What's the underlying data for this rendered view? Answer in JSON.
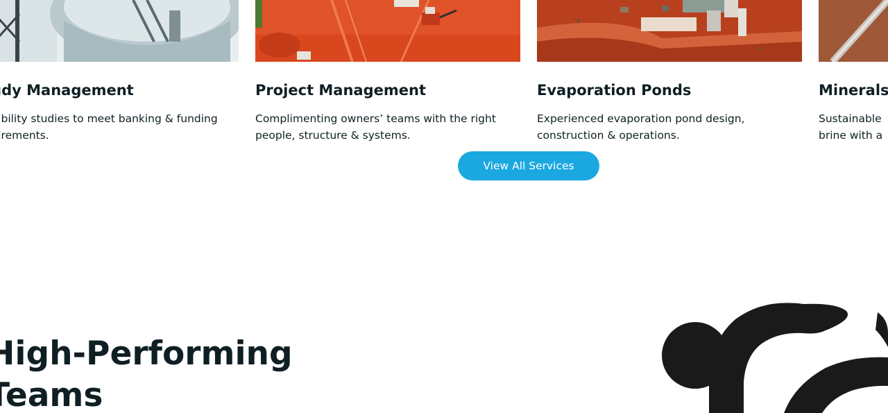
{
  "services": [
    {
      "title": "Study Management",
      "description_lines": [
        "Feasibility studies to meet banking & funding",
        "requirements."
      ],
      "image_icon": "tank-render-image"
    },
    {
      "title": "Project Management",
      "description_lines": [
        "Complimenting owners’ teams with the right",
        "people, structure & systems."
      ],
      "image_icon": "construction-site-image"
    },
    {
      "title": "Evaporation Ponds",
      "description_lines": [
        "Experienced evaporation pond design,",
        "construction & operations."
      ],
      "image_icon": "aerial-site-image"
    },
    {
      "title": "Minerals",
      "description_lines": [
        "Sustainable",
        "brine with a"
      ],
      "image_icon": "pipeline-image"
    }
  ],
  "view_all_button": {
    "label": "View All Services",
    "color": "#1ba8e0"
  },
  "team_section": {
    "heading_lines": [
      "High-Performing",
      "Teams"
    ]
  },
  "colors": {
    "text": "#0f1f24",
    "logo": "#1a1a1a"
  }
}
